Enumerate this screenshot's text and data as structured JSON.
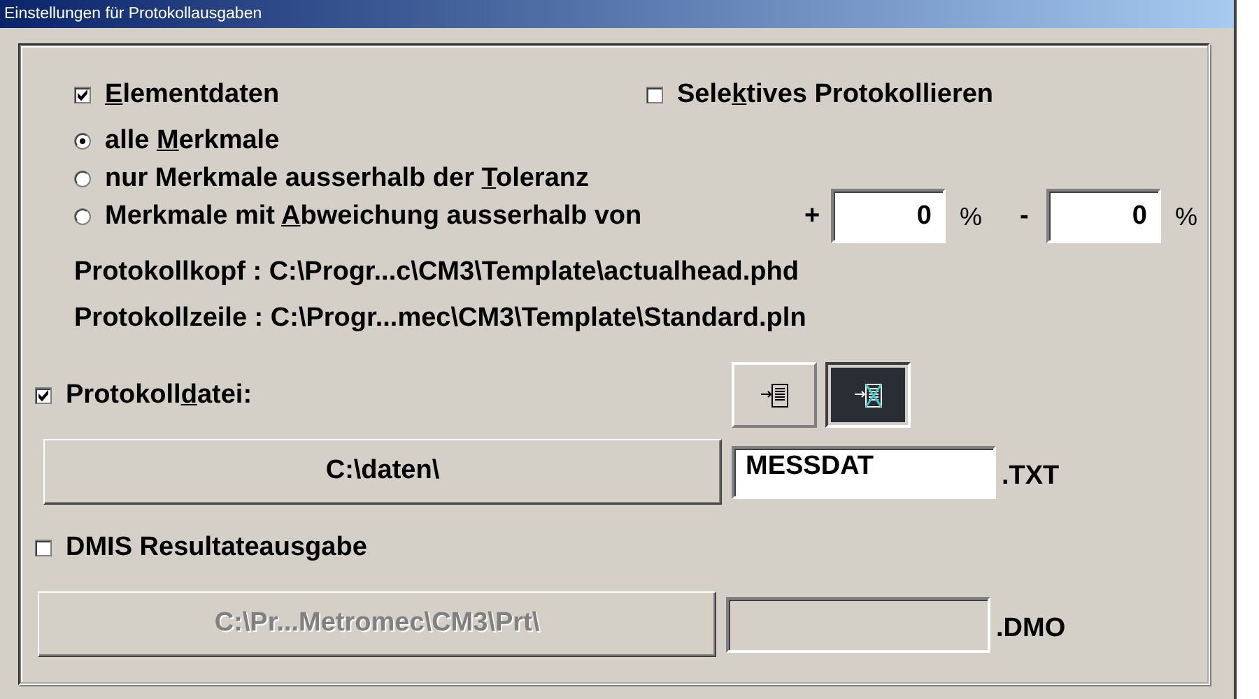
{
  "window": {
    "title": "Einstellungen für Protokollausgaben"
  },
  "element_data": {
    "key": "E",
    "after": "lementdaten",
    "checked": true
  },
  "selective": {
    "before": "Sele",
    "key": "k",
    "after": "tives Protokollieren",
    "checked": false
  },
  "radios": [
    {
      "before": "alle ",
      "key": "M",
      "after": "erkmale",
      "selected": true
    },
    {
      "before": "nur Merkmale ausserhalb der ",
      "key": "T",
      "after": "oleranz",
      "selected": false
    },
    {
      "before": "Merkmale mit ",
      "key": "A",
      "after": "bweichung ausserhalb von",
      "selected": false
    }
  ],
  "deviation": {
    "plus_sign": "+",
    "plus_value": "0",
    "plus_unit": "%",
    "minus_sign": "-",
    "minus_value": "0",
    "minus_unit": "%"
  },
  "info_lines": [
    "Protokollkopf : C:\\Progr...c\\CM3\\Template\\actualhead.phd",
    "Protokollzeile : C:\\Progr...mec\\CM3\\Template\\Standard.pln"
  ],
  "log_file": {
    "before": "Protokoll",
    "key": "d",
    "after": "atei:",
    "checked": true,
    "view_buttons": [
      {
        "kind": "plain",
        "selected": false
      },
      {
        "kind": "crossed",
        "selected": true
      }
    ],
    "folder_button": "C:\\daten\\",
    "file_name": "MESSDAT",
    "extension": ".TXT",
    "disabled": false
  },
  "dmis": {
    "before": "DMIS Resultateausgabe",
    "checked": false,
    "folder_button": "C:\\Pr...Metromec\\CM3\\Prt\\",
    "extension": ".DMO",
    "disabled": true
  }
}
